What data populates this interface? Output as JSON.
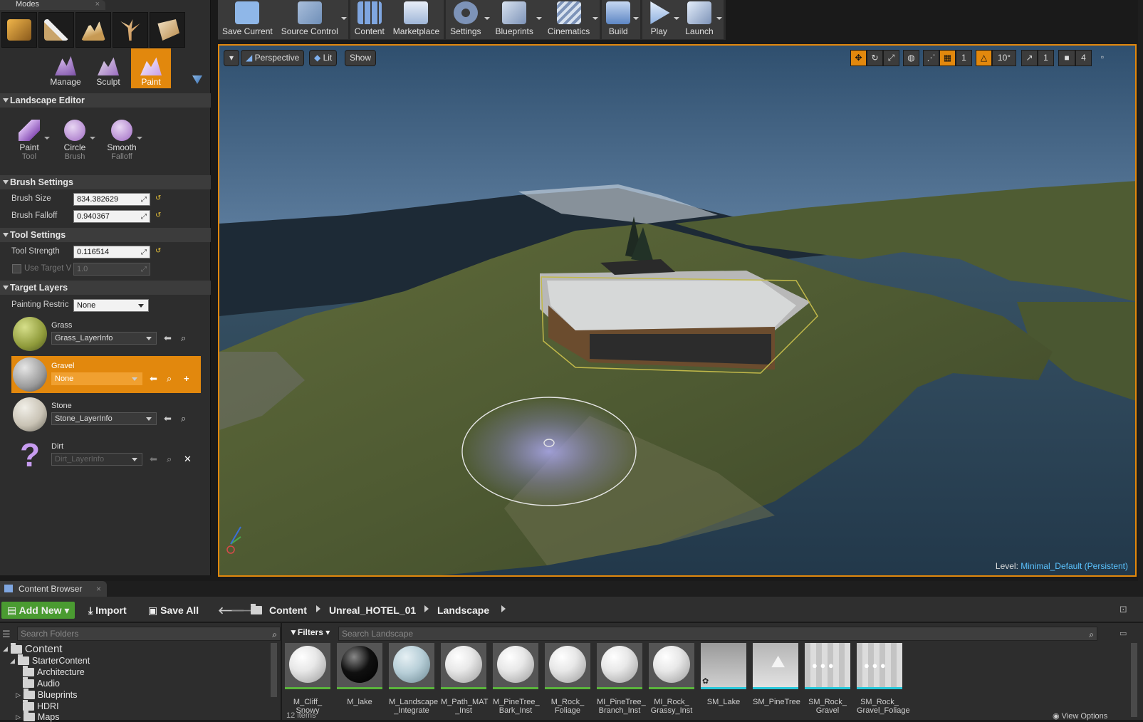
{
  "modes": {
    "tab_label": "Modes",
    "sub_modes": [
      {
        "label": "Manage",
        "active": false
      },
      {
        "label": "Sculpt",
        "active": false
      },
      {
        "label": "Paint",
        "active": true
      }
    ]
  },
  "landscape_editor": {
    "title": "Landscape Editor",
    "tools": [
      {
        "label": "Paint",
        "sub": "Tool"
      },
      {
        "label": "Circle",
        "sub": "Brush"
      },
      {
        "label": "Smooth",
        "sub": "Falloff"
      }
    ]
  },
  "brush_settings": {
    "title": "Brush Settings",
    "brush_size_label": "Brush Size",
    "brush_size_value": "834.382629",
    "brush_falloff_label": "Brush Falloff",
    "brush_falloff_value": "0.940367"
  },
  "tool_settings": {
    "title": "Tool Settings",
    "tool_strength_label": "Tool Strength",
    "tool_strength_value": "0.116514",
    "use_target_label": "Use Target V",
    "use_target_value": "1.0"
  },
  "target_layers": {
    "title": "Target Layers",
    "painting_restriction_label": "Painting Restric",
    "painting_restriction_value": "None",
    "layers": [
      {
        "name": "Grass",
        "info": "Grass_LayerInfo",
        "selected": false
      },
      {
        "name": "Gravel",
        "info": "None",
        "selected": true
      },
      {
        "name": "Stone",
        "info": "Stone_LayerInfo",
        "selected": false
      },
      {
        "name": "Dirt",
        "info": "Dirt_LayerInfo",
        "selected": false
      }
    ]
  },
  "toolbar": {
    "buttons": [
      {
        "label": "Save Current",
        "icon": "save-icon",
        "color": "#8fb7e8"
      },
      {
        "label": "Source Control",
        "icon": "source-control-icon",
        "color": "#6f8fb8"
      },
      {
        "label": "Content",
        "icon": "content-icon",
        "color": "#7fa6e0"
      },
      {
        "label": "Marketplace",
        "icon": "marketplace-icon",
        "color": "#b9cde8"
      },
      {
        "label": "Settings",
        "icon": "settings-icon",
        "color": "#7d93b8"
      },
      {
        "label": "Blueprints",
        "icon": "blueprints-icon",
        "color": "#9bb0cc"
      },
      {
        "label": "Cinematics",
        "icon": "cinematics-icon",
        "color": "#a8b9d2"
      },
      {
        "label": "Build",
        "icon": "build-icon",
        "color": "#8fb1e0"
      },
      {
        "label": "Play",
        "icon": "play-icon",
        "color": "#a9c6ec"
      },
      {
        "label": "Launch",
        "icon": "launch-icon",
        "color": "#9fb4d6"
      }
    ]
  },
  "viewport": {
    "perspective_label": "Perspective",
    "lit_label": "Lit",
    "show_label": "Show",
    "grid_snap_value": "1",
    "rotation_snap_value": "10°",
    "scale_snap_value": "1",
    "camera_speed_value": "4",
    "level_label": "Level:",
    "level_value": "Minimal_Default (Persistent)"
  },
  "content_browser": {
    "tab_label": "Content Browser",
    "add_new_label": "Add New",
    "import_label": "Import",
    "save_all_label": "Save All",
    "breadcrumbs": [
      "Content",
      "Unreal_HOTEL_01",
      "Landscape"
    ],
    "search_folders_placeholder": "Search Folders",
    "filters_label": "Filters",
    "search_assets_placeholder": "Search Landscape",
    "tree": [
      {
        "label": "Content",
        "level": 0
      },
      {
        "label": "StarterContent",
        "level": 1
      },
      {
        "label": "Architecture",
        "level": 2
      },
      {
        "label": "Audio",
        "level": 2
      },
      {
        "label": "Blueprints",
        "level": 2
      },
      {
        "label": "HDRI",
        "level": 2
      },
      {
        "label": "Maps",
        "level": 2
      }
    ],
    "assets": [
      {
        "label": "M_Cliff_\nSnowy",
        "kind": "material",
        "color": "#e8e8e8",
        "bar": "#5ab53c"
      },
      {
        "label": "M_lake",
        "kind": "material",
        "color": "#101010",
        "bar": "#5ab53c"
      },
      {
        "label": "M_Landscape\n_Integrate",
        "kind": "material",
        "color": "#b8cfd8",
        "bar": "#5ab53c"
      },
      {
        "label": "M_Path_MAT\n_Inst",
        "kind": "material",
        "color": "#e8e8e8",
        "bar": "#5ab53c"
      },
      {
        "label": "M_PineTree_\nBark_Inst",
        "kind": "material",
        "color": "#e8e8e8",
        "bar": "#5ab53c"
      },
      {
        "label": "M_Rock_\nFoliage",
        "kind": "material",
        "color": "#e8e8e8",
        "bar": "#5ab53c"
      },
      {
        "label": "MI_PineTree_\nBranch_Inst",
        "kind": "material",
        "color": "#e8e8e8",
        "bar": "#5ab53c"
      },
      {
        "label": "MI_Rock_\nGrassy_Inst",
        "kind": "material",
        "color": "#e8e8e8",
        "bar": "#5ab53c"
      },
      {
        "label": "SM_Lake",
        "kind": "mesh",
        "color": "#bfbfbf",
        "bar": "#27c7d9"
      },
      {
        "label": "SM_PineTree",
        "kind": "mesh",
        "color": "#d9d9d9",
        "bar": "#27c7d9"
      },
      {
        "label": "SM_Rock_\nGravel",
        "kind": "mesh",
        "color": "#cfcfcf",
        "bar": "#27c7d9"
      },
      {
        "label": "SM_Rock_\nGravel_Foliage",
        "kind": "mesh",
        "color": "#cfcfcf",
        "bar": "#27c7d9"
      }
    ],
    "item_count": "12 items",
    "view_options_label": "View Options"
  }
}
